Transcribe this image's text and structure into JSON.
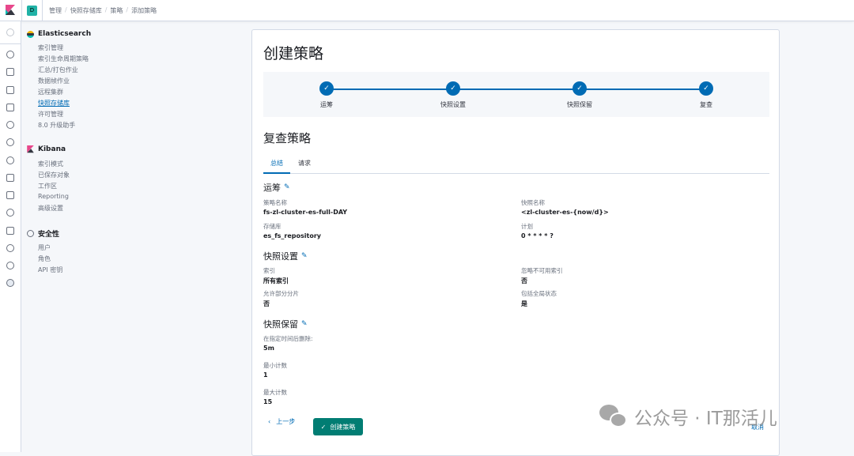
{
  "header": {
    "space_initial": "D",
    "breadcrumbs": [
      "管理",
      "快照存储库",
      "策略",
      "添加策略"
    ]
  },
  "sidebar": {
    "sections": [
      {
        "title": "Elasticsearch",
        "icon": "elasticsearch-icon",
        "items": [
          "索引管理",
          "索引生命周期策略",
          "汇总/打包作业",
          "数据帧作业",
          "远程集群",
          "快照存储库",
          "许可管理",
          "8.0 升级助手"
        ],
        "active": "快照存储库"
      },
      {
        "title": "Kibana",
        "icon": "kibana-icon",
        "items": [
          "索引模式",
          "已保存对象",
          "工作区",
          "Reporting",
          "高级设置"
        ]
      },
      {
        "title": "安全性",
        "icon": "shield-icon",
        "items": [
          "用户",
          "角色",
          "API 密钥"
        ]
      }
    ]
  },
  "rail": {
    "icons": [
      "clock-icon",
      "discover-icon",
      "visualize-icon",
      "dashboard-icon",
      "canvas-icon",
      "maps-icon",
      "ml-icon",
      "infra-icon",
      "logs-icon",
      "apm-icon",
      "uptime-icon",
      "siem-icon",
      "devtools-icon",
      "monitoring-icon",
      "management-icon"
    ]
  },
  "page": {
    "title": "创建策略",
    "steps": [
      "运筹",
      "快照设置",
      "快照保留",
      "复查"
    ],
    "review_title": "复查策略",
    "tabs": [
      "总结",
      "请求"
    ],
    "logistics": {
      "title": "运筹",
      "policy_name_label": "策略名称",
      "policy_name": "fs-zl-cluster-es-full-DAY",
      "snapshot_name_label": "快照名称",
      "snapshot_name": "<zl-cluster-es-{now/d}>",
      "repo_label": "存储库",
      "repo": "es_fs_repository",
      "schedule_label": "计划",
      "schedule": "0 * * * * ?"
    },
    "settings": {
      "title": "快照设置",
      "indices_label": "索引",
      "indices": "所有索引",
      "ignore_label": "忽略不可用索引",
      "ignore": "否",
      "partial_label": "允许部分分片",
      "partial": "否",
      "global_label": "包括全局状态",
      "global": "是"
    },
    "retention": {
      "title": "快照保留",
      "expire_label": "在指定时间后删除:",
      "expire": "5m",
      "min_label": "最小计数",
      "min": "1",
      "max_label": "最大计数",
      "max": "15"
    },
    "buttons": {
      "prev": "上一步",
      "create": "创建策略",
      "cancel": "取消"
    }
  },
  "watermark": "公众号 · IT那活儿",
  "colors": {
    "primary": "#006bb4",
    "success": "#017d73"
  }
}
